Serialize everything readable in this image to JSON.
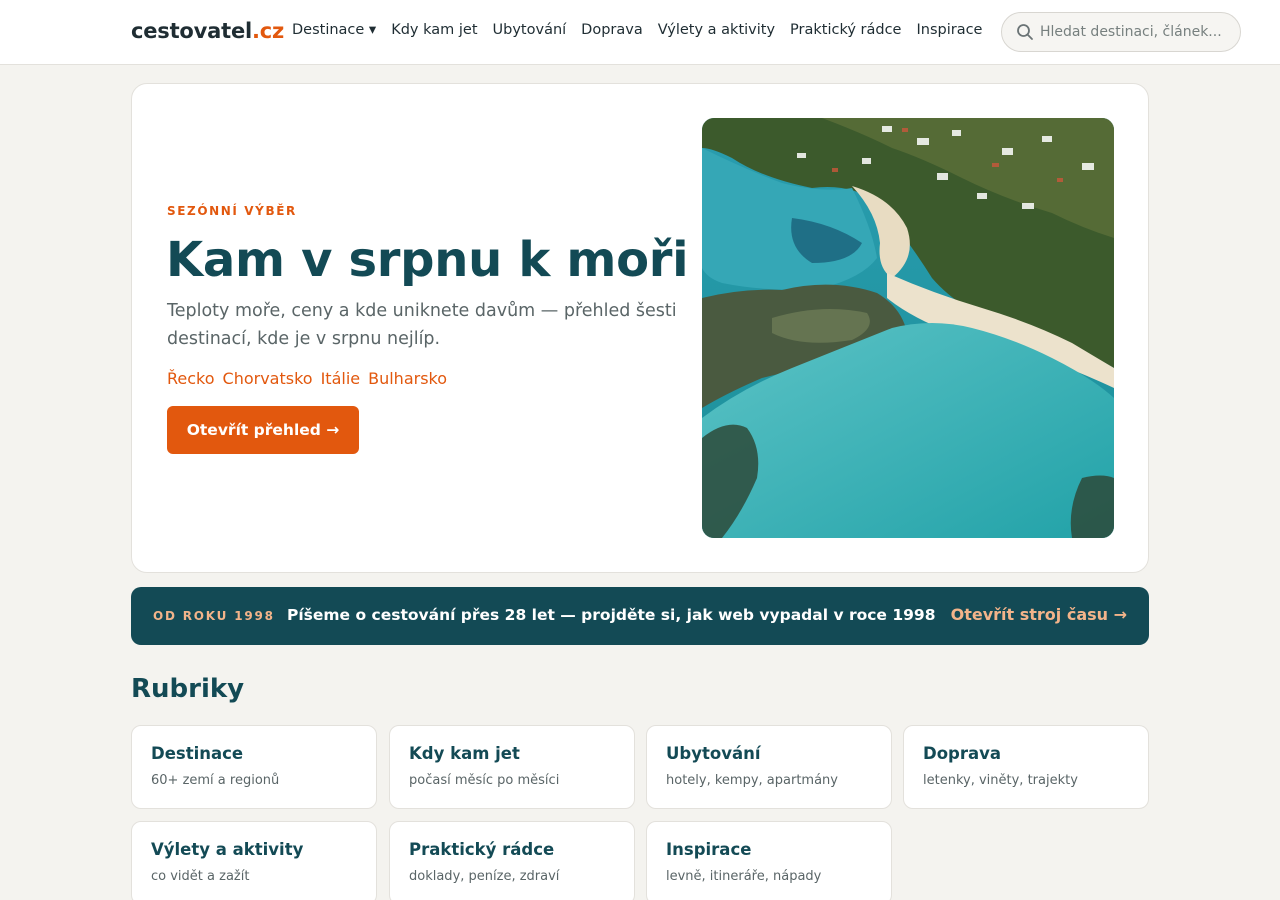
{
  "header": {
    "logo_name": "cestovatel",
    "logo_tld": ".cz",
    "nav": [
      {
        "label": "Destinace ▾"
      },
      {
        "label": "Kdy kam jet"
      },
      {
        "label": "Ubytování"
      },
      {
        "label": "Doprava"
      },
      {
        "label": "Výlety a aktivity"
      },
      {
        "label": "Praktický rádce"
      },
      {
        "label": "Inspirace"
      }
    ],
    "search": {
      "placeholder": "Hledat destinaci, článek...",
      "value": "",
      "icon": "search-icon"
    }
  },
  "hero": {
    "eyebrow": "SEZÓNNÍ VÝBĚR",
    "title": "Kam v srpnu k moři",
    "lead": "Teploty moře, ceny a kde uniknete davům — přehled šesti destinací, kde je v srpnu nejlíp.",
    "tags": [
      "Řecko",
      "Chorvatsko",
      "Itálie",
      "Bulharsko"
    ],
    "cta": "Otevřít přehled →"
  },
  "banner": {
    "eyebrow": "OD ROKU 1998",
    "text": "Píšeme o cestování přes 28 let — projděte si, jak web vypadal v roce 1998",
    "link": "Otevřít stroj času →"
  },
  "categories": {
    "title": "Rubriky",
    "items": [
      {
        "title": "Destinace",
        "sub": "60+ zemí a regionů"
      },
      {
        "title": "Kdy kam jet",
        "sub": "počasí měsíc po měsíci"
      },
      {
        "title": "Ubytování",
        "sub": "hotely, kempy, apartmány"
      },
      {
        "title": "Doprava",
        "sub": "letenky, viněty, trajekty"
      },
      {
        "title": "Výlety a aktivity",
        "sub": "co vidět a zažít"
      },
      {
        "title": "Praktický rádce",
        "sub": "doklady, peníze, zdraví"
      },
      {
        "title": "Inspirace",
        "sub": "levně, itineráře, nápady"
      }
    ]
  },
  "colors": {
    "accent": "#e2580e",
    "brand": "#134a55",
    "background": "#f4f3ef"
  }
}
